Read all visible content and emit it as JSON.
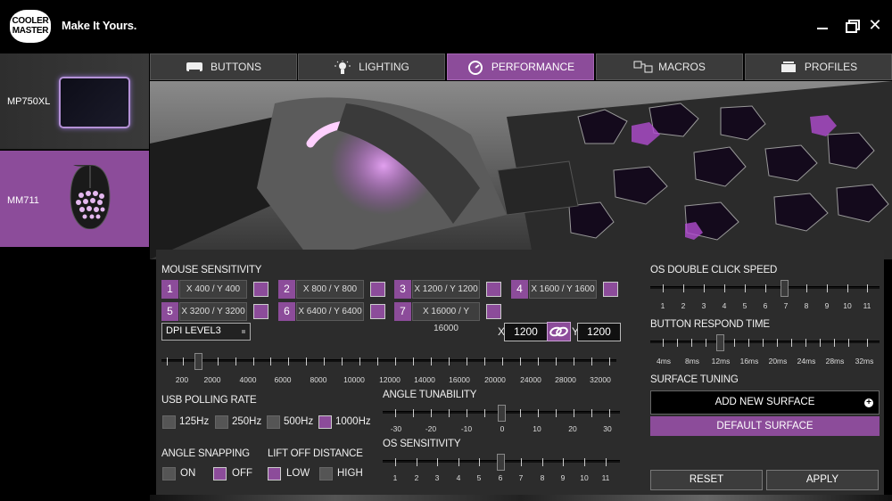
{
  "brand": {
    "logo_line1": "COOLER",
    "logo_line2": "MASTER",
    "tagline": "Make It Yours."
  },
  "window": {
    "close_glyph": "✕"
  },
  "devices": [
    {
      "label": "MP750XL",
      "selected": false
    },
    {
      "label": "MM711",
      "selected": true
    }
  ],
  "tabs": [
    {
      "label": "BUTTONS",
      "icon": "keyboard-icon",
      "active": false
    },
    {
      "label": "LIGHTING",
      "icon": "bulb-icon",
      "active": false
    },
    {
      "label": "PERFORMANCE",
      "icon": "gauge-icon",
      "active": true
    },
    {
      "label": "MACROS",
      "icon": "macro-icon",
      "active": false
    },
    {
      "label": "PROFILES",
      "icon": "profiles-icon",
      "active": false
    }
  ],
  "mouse_sensitivity": {
    "title": "MOUSE SENSITIVITY",
    "levels": [
      {
        "num": "1",
        "value": "X 400 / Y 400"
      },
      {
        "num": "2",
        "value": "X 800 / Y 800"
      },
      {
        "num": "3",
        "value": "X 1200 / Y 1200"
      },
      {
        "num": "4",
        "value": "X 1600 / Y 1600"
      },
      {
        "num": "5",
        "value": "X 3200 / Y 3200"
      },
      {
        "num": "6",
        "value": "X 6400 / Y 6400"
      },
      {
        "num": "7",
        "value": "X 16000 / Y 16000"
      }
    ],
    "selected_level": "DPI LEVEL3",
    "x_label": "X",
    "y_label": "Y",
    "x_value": "1200",
    "y_value": "1200",
    "scale": [
      "200",
      "2000",
      "4000",
      "6000",
      "8000",
      "10000",
      "12000",
      "14000",
      "16000",
      "20000",
      "24000",
      "28000",
      "32000"
    ]
  },
  "usb_polling": {
    "title": "USB POLLING RATE",
    "options": [
      {
        "label": "125Hz",
        "checked": false
      },
      {
        "label": "250Hz",
        "checked": false
      },
      {
        "label": "500Hz",
        "checked": false
      },
      {
        "label": "1000Hz",
        "checked": true
      }
    ]
  },
  "angle_tunability": {
    "title": "ANGLE TUNABILITY",
    "scale": [
      "-30",
      "-20",
      "-10",
      "0",
      "10",
      "20",
      "30"
    ],
    "value": "0"
  },
  "os_sensitivity": {
    "title": "OS SENSITIVITY",
    "scale": [
      "1",
      "2",
      "3",
      "4",
      "5",
      "6",
      "7",
      "8",
      "9",
      "10",
      "11"
    ],
    "value": "6"
  },
  "angle_snapping": {
    "title": "ANGLE SNAPPING",
    "on_label": "ON",
    "off_label": "OFF",
    "value": "OFF"
  },
  "lift_off": {
    "title": "LIFT OFF DISTANCE",
    "low_label": "LOW",
    "high_label": "HIGH",
    "value": "LOW"
  },
  "double_click": {
    "title": "OS DOUBLE CLICK SPEED",
    "scale": [
      "1",
      "2",
      "3",
      "4",
      "5",
      "6",
      "7",
      "8",
      "9",
      "10",
      "11"
    ],
    "value": "7"
  },
  "respond_time": {
    "title": "BUTTON RESPOND TIME",
    "scale": [
      "4ms",
      "8ms",
      "12ms",
      "16ms",
      "20ms",
      "24ms",
      "28ms",
      "32ms"
    ],
    "value": "12ms"
  },
  "surface": {
    "title": "SURFACE TUNING",
    "add_label": "ADD NEW SURFACE",
    "default_label": "DEFAULT SURFACE"
  },
  "footer": {
    "reset_label": "RESET",
    "apply_label": "APPLY"
  },
  "colors": {
    "accent": "#8c4c9a",
    "panel": "#2c2c2c",
    "tab": "#3b3b3b"
  }
}
